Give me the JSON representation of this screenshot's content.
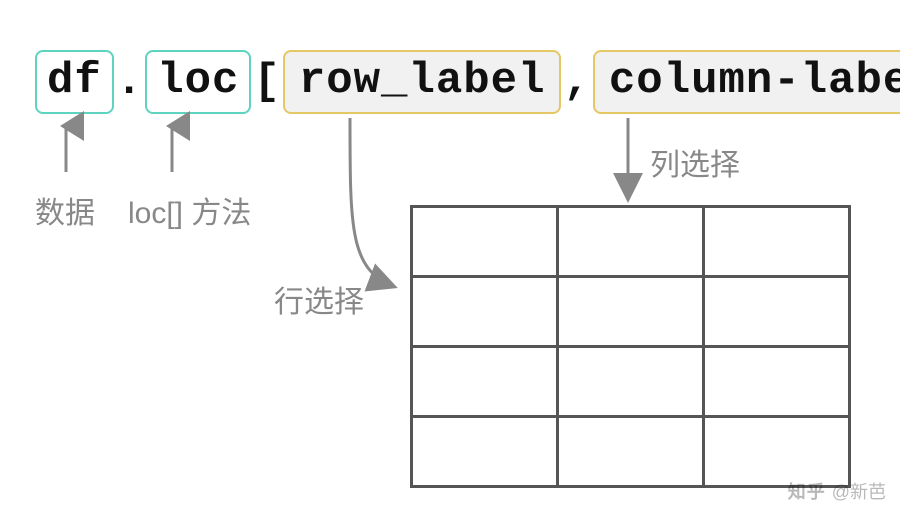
{
  "syntax": {
    "df": "df",
    "dot": ".",
    "loc": "loc",
    "lbracket": "[",
    "row_label": "row_label",
    "comma": ",",
    "column_label": "column-label",
    "rbracket": "]"
  },
  "labels": {
    "data": "数据",
    "loc_method": "loc[] 方法",
    "row_sel": "行选择",
    "col_sel": "列选择"
  },
  "watermark": {
    "logo": "知乎",
    "handle": "@新芭"
  }
}
